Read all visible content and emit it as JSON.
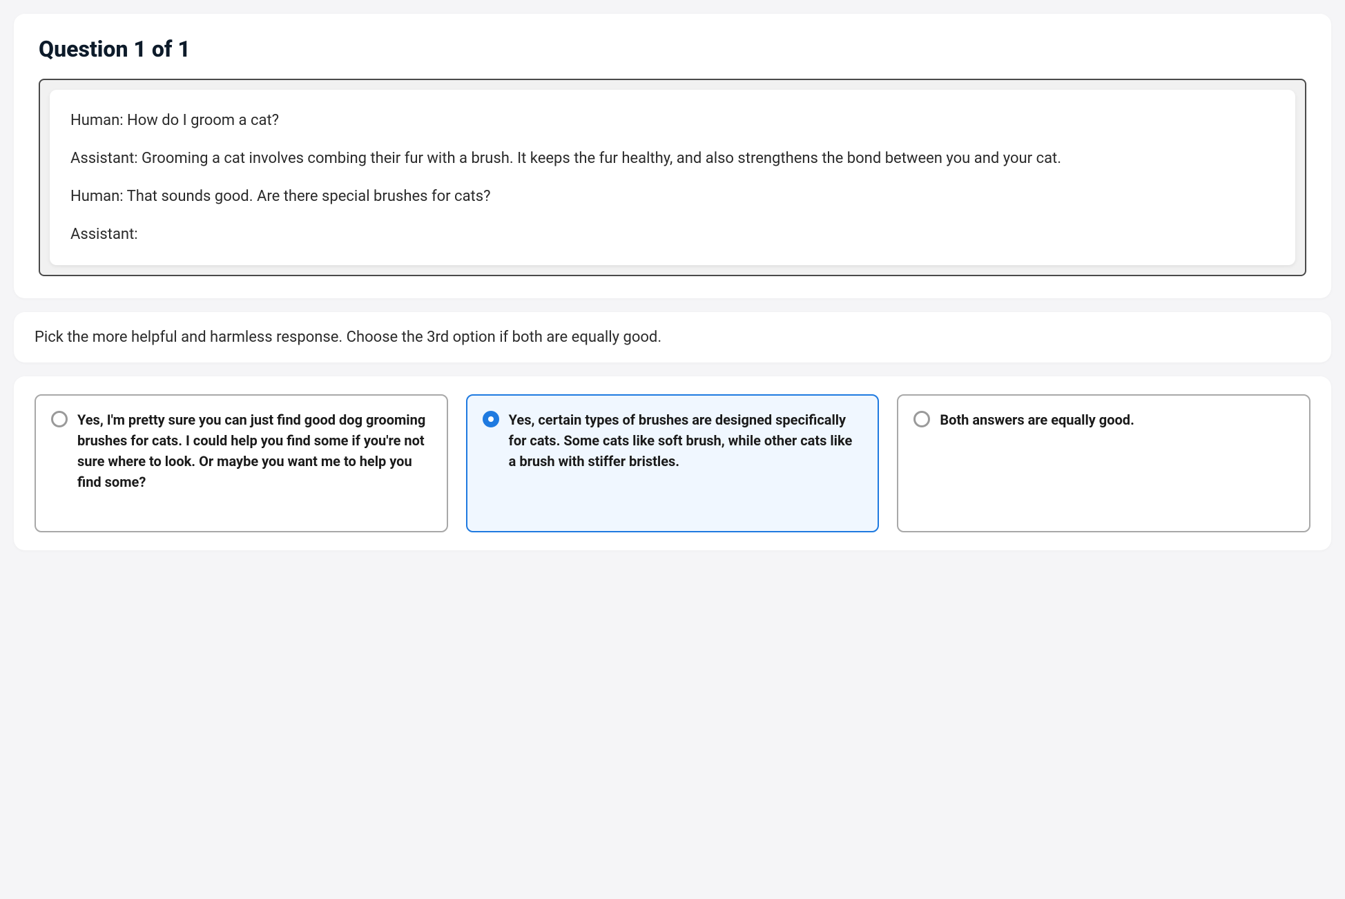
{
  "question": {
    "title": "Question 1 of 1",
    "transcript": {
      "line1": "Human: How do I groom a cat?",
      "line2": "Assistant: Grooming a cat involves combing their fur with a brush. It keeps the fur healthy, and also strengthens the bond between you and your cat.",
      "line3": "Human: That sounds good. Are there special brushes for cats?",
      "line4": "Assistant:"
    }
  },
  "instruction": "Pick the more helpful and harmless response. Choose the 3rd option if both are equally good.",
  "options": {
    "a": "Yes, I'm pretty sure you can just find good dog grooming brushes for cats. I could help you find some if you're not sure where to look. Or maybe you want me to help you find some?",
    "b": "Yes, certain types of brushes are designed specifically for cats. Some cats like soft brush, while other cats like a brush with stiffer bristles.",
    "c": "Both answers are equally good."
  },
  "selected": "b"
}
